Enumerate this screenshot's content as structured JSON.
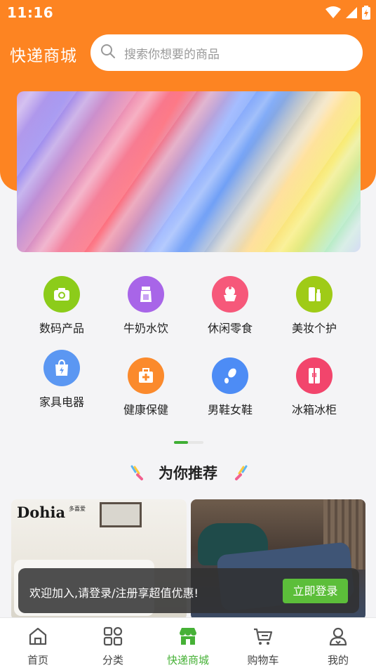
{
  "status_bar": {
    "time": "11:16"
  },
  "header": {
    "app_title": "快递商城",
    "search_placeholder": "搜索你想要的商品"
  },
  "categories": [
    {
      "label": "数码产品",
      "icon": "camera-icon",
      "color": "#8ccc1a"
    },
    {
      "label": "牛奶水饮",
      "icon": "milk-icon",
      "color": "#a865e8"
    },
    {
      "label": "休闲零食",
      "icon": "cake-icon",
      "color": "#f6587a"
    },
    {
      "label": "美妆个护",
      "icon": "cosmetics-icon",
      "color": "#9fcb17"
    },
    {
      "label": "家具电器",
      "icon": "shopping-bag-bolt-icon",
      "color": "#5b97f2"
    },
    {
      "label": "健康保健",
      "icon": "medical-kit-icon",
      "color": "#fb8a2c"
    },
    {
      "label": "男鞋女鞋",
      "icon": "shoe-icon",
      "color": "#4d8cf5"
    },
    {
      "label": "冰箱冰柜",
      "icon": "fridge-icon",
      "color": "#f2456c"
    }
  ],
  "recommend": {
    "title": "为你推荐"
  },
  "products": [
    {
      "brand": "Dohia",
      "brand_sub": "多喜爱"
    },
    {
      "brand": ""
    }
  ],
  "login_prompt": {
    "text": "欢迎加入,请登录/注册享超值优惠!",
    "button_label": "立即登录"
  },
  "tabbar": {
    "items": [
      {
        "label": "首页",
        "icon": "home-icon"
      },
      {
        "label": "分类",
        "icon": "category-grid-icon"
      },
      {
        "label": "快递商城",
        "icon": "store-icon",
        "active": true
      },
      {
        "label": "购物车",
        "icon": "cart-icon"
      },
      {
        "label": "我的",
        "icon": "user-icon"
      }
    ]
  },
  "colors": {
    "brand_orange": "#fd8422",
    "accent_green": "#46b136",
    "login_button_green": "#5cbe3a"
  }
}
